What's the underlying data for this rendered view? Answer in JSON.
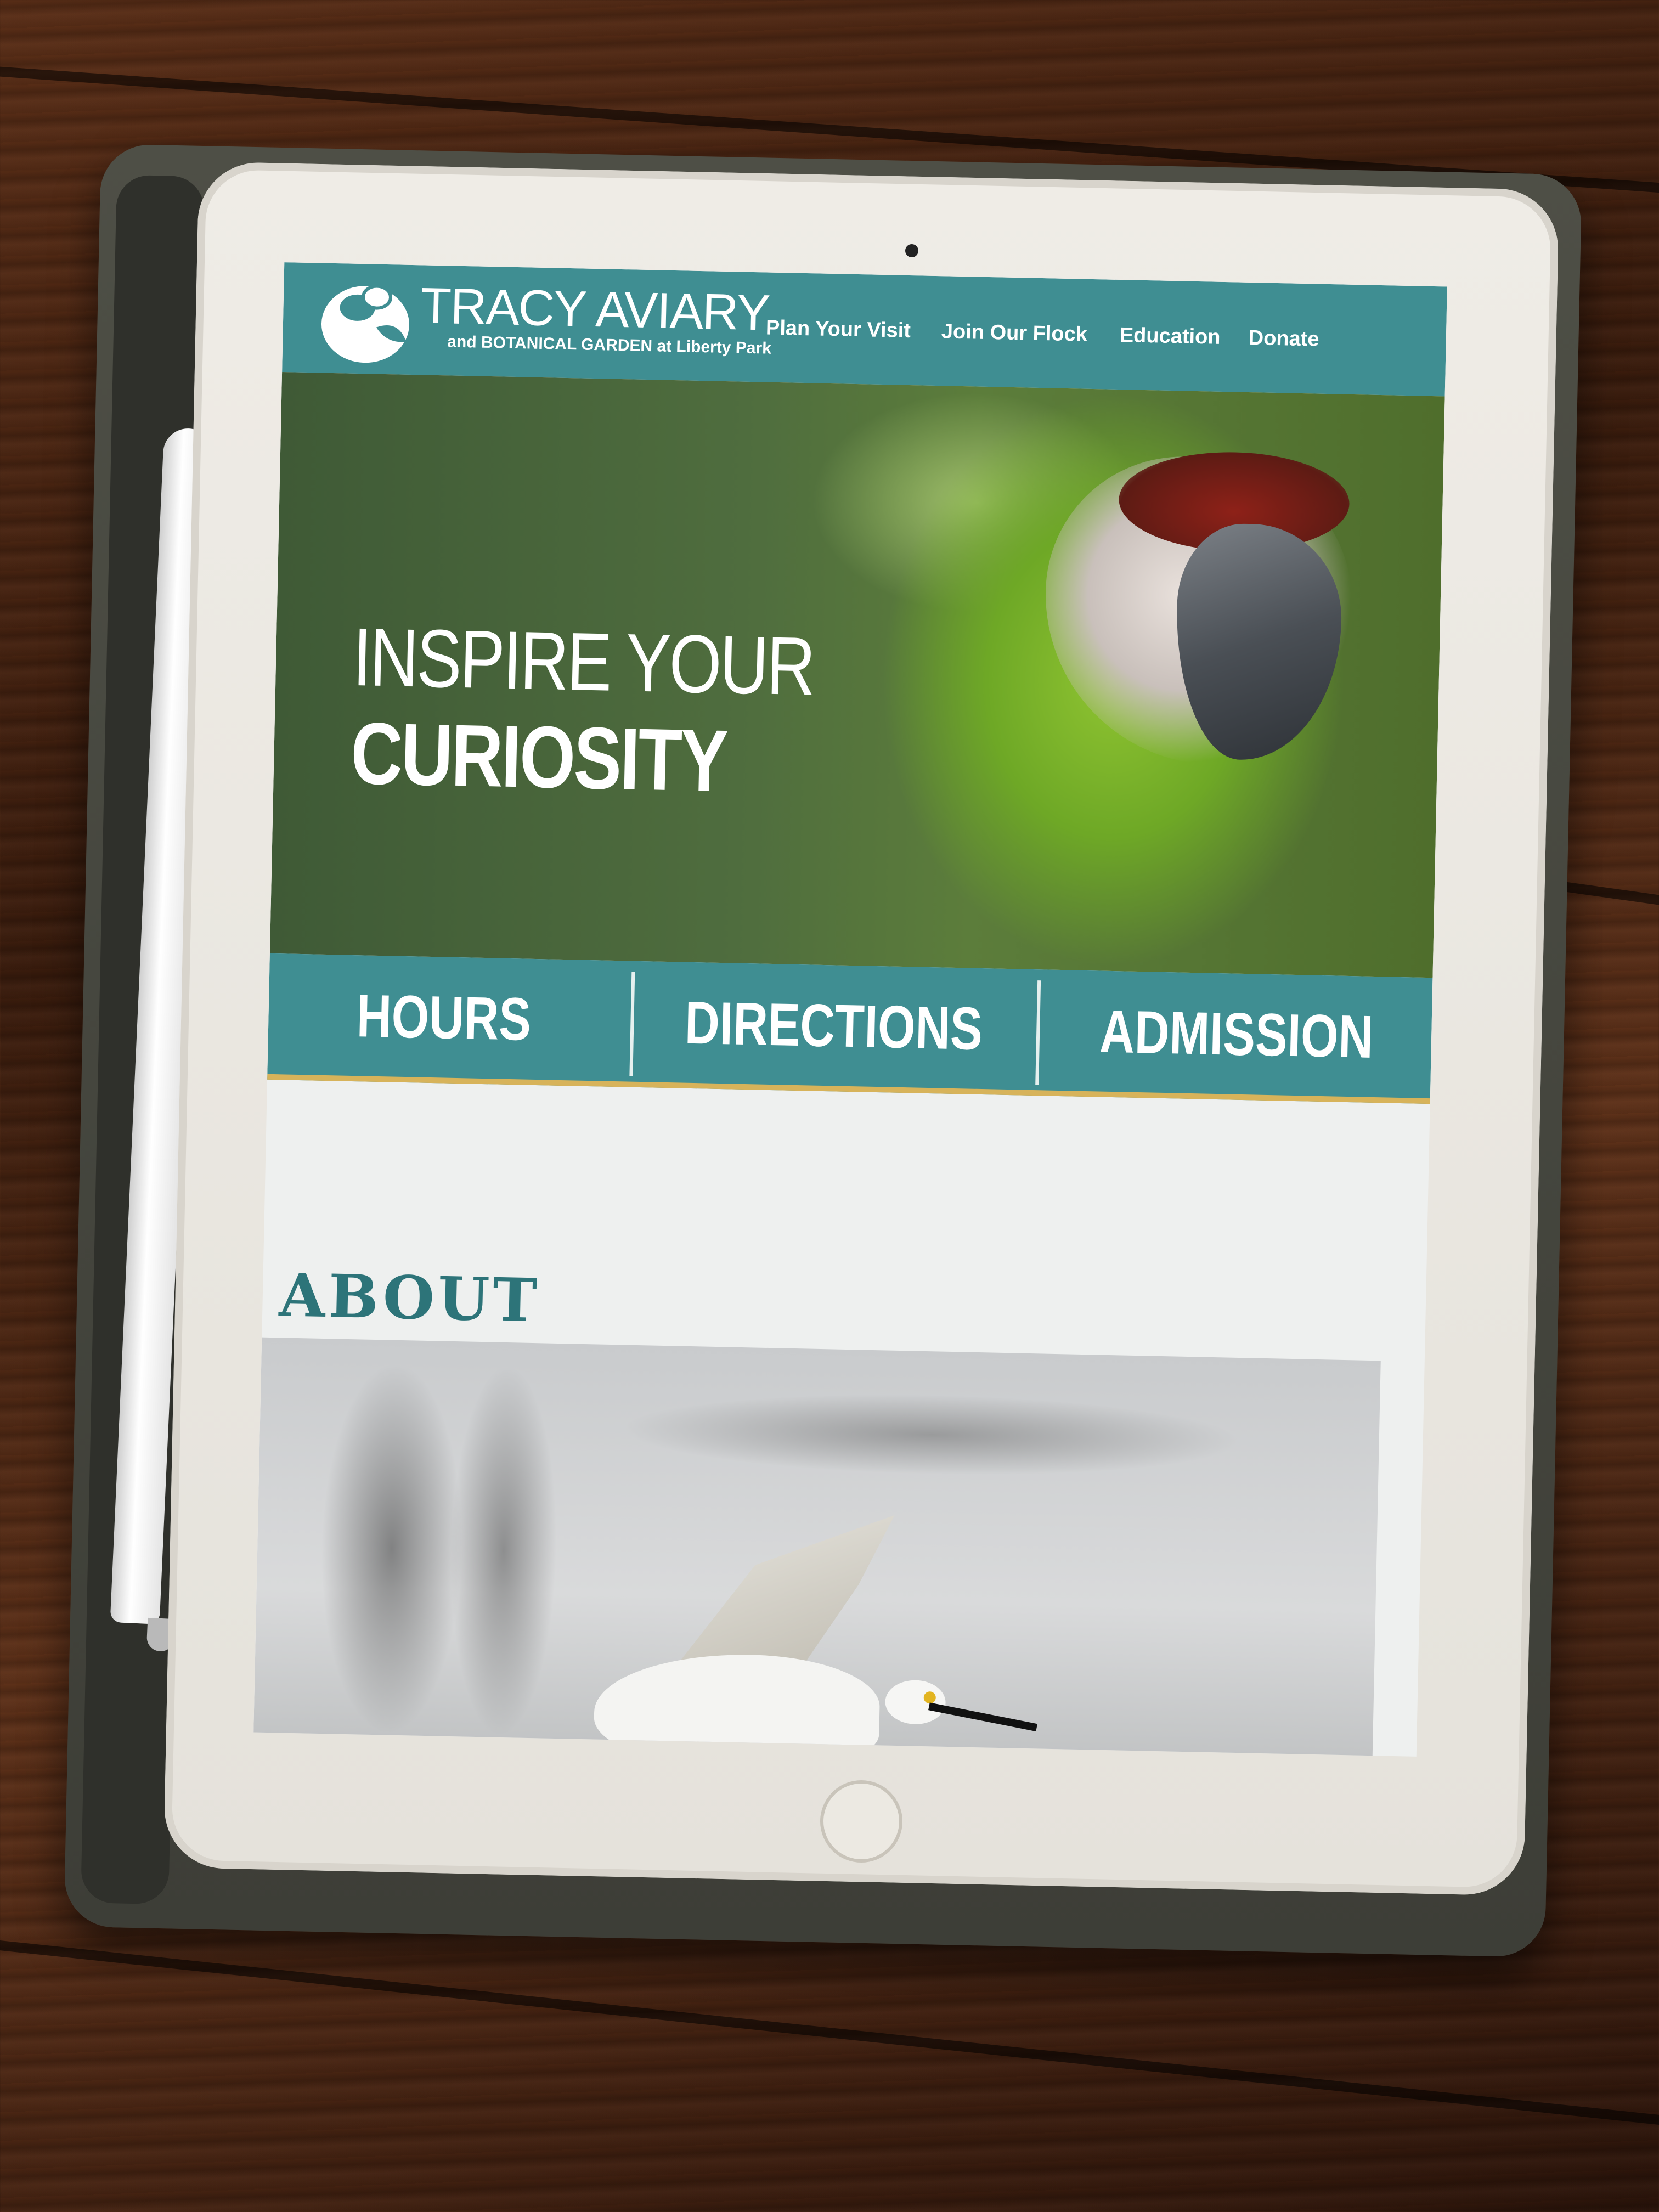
{
  "site": {
    "logo_title": "TRACY AVIARY",
    "logo_subtitle": "and BOTANICAL GARDEN at Liberty Park",
    "nav": [
      {
        "label": "Plan Your Visit"
      },
      {
        "label": "Join Our Flock"
      },
      {
        "label": "Education"
      },
      {
        "label": "Donate"
      }
    ]
  },
  "hero": {
    "line1": "INSPIRE YOUR",
    "line2": "CURIOSITY"
  },
  "quick_links": [
    {
      "label": "HOURS"
    },
    {
      "label": "DIRECTIONS"
    },
    {
      "label": "ADMISSION"
    }
  ],
  "about": {
    "heading": "ABOUT"
  },
  "colors": {
    "brand_teal": "#3f8e92",
    "accent_gold": "#d7b35a",
    "heading_teal": "#2d7479"
  },
  "icons": {
    "logo": "bird-logo-icon"
  }
}
